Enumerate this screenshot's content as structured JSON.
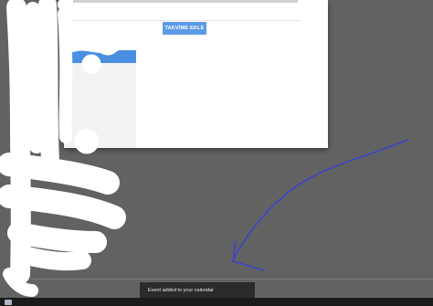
{
  "dialog": {
    "add_to_calendar_label": "TAKVİME EKLE"
  },
  "toast": {
    "message": "Event added to your calendar"
  },
  "colors": {
    "accent": "#5b9be6",
    "annotation": "#3d43c9",
    "redaction": "#ffffff"
  },
  "icons": {
    "taskbar": "app-icon"
  }
}
